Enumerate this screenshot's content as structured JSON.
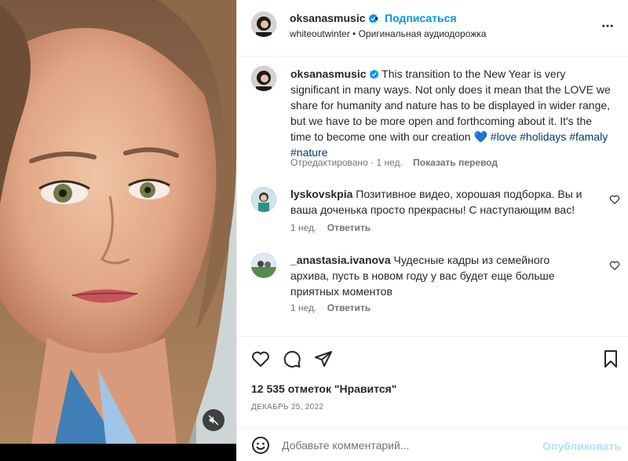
{
  "header": {
    "username": "oksanasmusic",
    "dot": "•",
    "follow_label": "Подписаться",
    "audio_line": "whiteoutwinter • Оригинальная аудиодорожка",
    "more_icon": "more-horizontal-icon"
  },
  "caption": {
    "username": "oksanasmusic",
    "text": "This transition to the New Year is very significant in many ways. Not only does it mean that the LOVE we share for humanity and nature has to be displayed in wider range, but we have to be more open and forthcoming about it. It's the time to become one with our creation 💙",
    "tags": [
      "#love",
      "#holidays",
      "#famaly",
      "#nature"
    ],
    "edited": "Отредактировано",
    "time": "1 нед.",
    "translate_label": "Показать перевод"
  },
  "comments": [
    {
      "username": "lyskovskpia",
      "text": "Позитивное видео, хорошая подборка. Вы и ваша доченька просто прекрасны! С наступающим вас!",
      "time": "1 нед.",
      "reply_label": "Ответить"
    },
    {
      "username": "_anastasia.ivanova",
      "text": "Чудесные кадры из семейного архива, пусть в новом году у вас будет еще больше приятных моментов",
      "time": "1 нед.",
      "reply_label": "Ответить"
    }
  ],
  "actions": {
    "likes_text": "12 535 отметок \"Нравится\"",
    "date": "ДЕКАБРЬ 25, 2022"
  },
  "composer": {
    "placeholder": "Добавьте комментарий...",
    "publish_label": "Опубликовать"
  },
  "colors": {
    "link_blue": "#0095f6",
    "tag_blue": "#00376b",
    "muted": "#737373",
    "publish_disabled": "#b2dffc"
  }
}
